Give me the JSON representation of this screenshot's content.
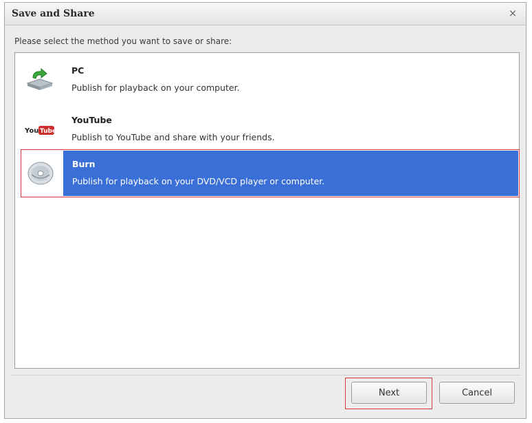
{
  "window": {
    "title": "Save and Share",
    "close_glyph": "×"
  },
  "prompt": "Please select the method you want to save or share:",
  "options": [
    {
      "name": "PC",
      "description": "Publish for playback on your computer.",
      "icon": "computer-upload-icon",
      "selected": false
    },
    {
      "name": "YouTube",
      "description": "Publish to YouTube and share with your friends.",
      "icon": "youtube-logo-icon",
      "selected": false
    },
    {
      "name": "Burn",
      "description": "Publish for playback on your DVD/VCD player or computer.",
      "icon": "disc-icon",
      "selected": true
    }
  ],
  "buttons": {
    "next": "Next",
    "cancel": "Cancel"
  },
  "colors": {
    "selection": "#3b6fd8",
    "highlight_border": "#d63a3a",
    "youtube_red": "#cc2d2d"
  }
}
